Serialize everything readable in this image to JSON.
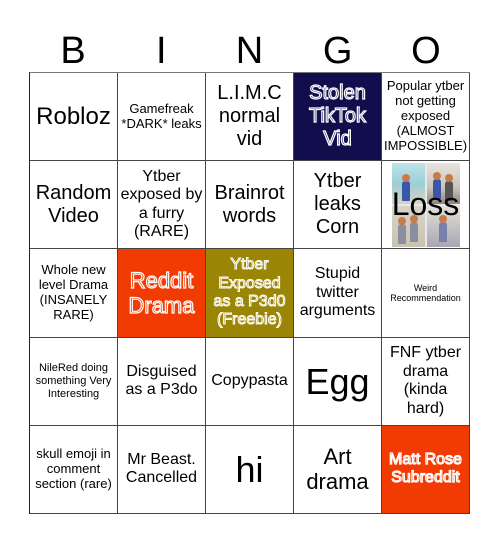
{
  "header": {
    "letters": [
      "B",
      "I",
      "N",
      "G",
      "O"
    ]
  },
  "colors": {
    "navy": "#120e4e",
    "orange": "#f23b02",
    "olive": "#9b8505"
  },
  "cells": [
    [
      "Robloz",
      "Gamefreak *DARK* leaks",
      "L.I.M.C normal vid",
      "Stolen TikTok Vid",
      "Popular ytber not getting exposed (ALMOST IMPOSSIBLE)"
    ],
    [
      "Random Video",
      "Ytber exposed by a furry (RARE)",
      "Brainrot words",
      "Ytber leaks Corn",
      "Loss"
    ],
    [
      "Whole new level Drama (INSANELY RARE)",
      "Reddit Drama",
      "Ytber Exposed as a P3d0 (Freebie)",
      "Stupid twitter arguments",
      "Weird Recommendation"
    ],
    [
      "NileRed doing something Very Interesting",
      "Disguised as a P3do",
      "Copypasta",
      "Egg",
      "FNF ytber drama (kinda hard)"
    ],
    [
      "skull emoji in comment section (rare)",
      "Mr Beast. Cancelled",
      "hi",
      "Art drama",
      "Matt Rose Subreddit"
    ]
  ]
}
